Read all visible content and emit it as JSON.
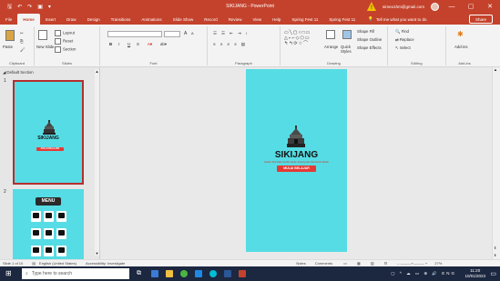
{
  "window": {
    "title": "SIKIJANG - PowerPoint",
    "account": "sirneo1hm@gmail.com",
    "minimize": "—",
    "maximize": "▢",
    "close": "✕"
  },
  "quick_access": {
    "save": "🖫",
    "undo": "↶",
    "redo": "↷",
    "start": "▣",
    "more": "▾"
  },
  "tabs": [
    "File",
    "Home",
    "Insert",
    "Draw",
    "Design",
    "Transitions",
    "Animations",
    "Slide Show",
    "Record",
    "Review",
    "View",
    "Help",
    "Spring Fest 11",
    "Spring Fest 11"
  ],
  "active_tab": "Home",
  "tell_me": "Tell me what you want to do",
  "share": "Share",
  "ribbon": {
    "clipboard": {
      "label": "Clipboard",
      "paste": "Paste"
    },
    "slides": {
      "label": "Slides",
      "new_slide": "New Slide",
      "layout": "Layout",
      "reset": "Reset",
      "section": "Section"
    },
    "font": {
      "label": "Font",
      "bold": "B",
      "italic": "I",
      "underline": "U",
      "strike": "S",
      "grow": "A",
      "shrink": "A"
    },
    "paragraph": {
      "label": "Paragraph"
    },
    "drawing": {
      "label": "Drawing",
      "arrange": "Arrange",
      "quick_styles": "Quick Styles",
      "shape_fill": "Shape Fill",
      "shape_outline": "Shape Outline",
      "shape_effects": "Shape Effects"
    },
    "editing": {
      "label": "Editing",
      "find": "Find",
      "replace": "Replace",
      "select": "Select"
    },
    "addins": {
      "label": "Add-ins",
      "addins": "Add-ins"
    }
  },
  "slides_panel": {
    "section": "Default Section",
    "slide1_num": "1",
    "slide2_num": "2",
    "slide1_title": "SIKIJANG",
    "slide1_button": "MULAI BELAJAR",
    "slide2_menu": "MENU",
    "slide2_labels": [
      "Materi",
      "Video",
      "Latihan",
      "Tentang",
      "Profil",
      "Evaluasi"
    ]
  },
  "slide": {
    "title": "SIKIJANG",
    "subtitle": "Sistem Kiat Kilas Cerdik Gerak Jantung dan Pembuluh Darah",
    "button": "MULAI BELAJAR"
  },
  "status": {
    "slide_of": "Slide 1 of 10",
    "language": "English (United States)",
    "accessibility": "Accessibility: Investigate",
    "notes": "Notes",
    "comments": "Comments",
    "zoom": "27%"
  },
  "taskbar": {
    "search": "Type here to search",
    "lang": "ENG",
    "time": "11:20",
    "date": "10/01/2023"
  }
}
